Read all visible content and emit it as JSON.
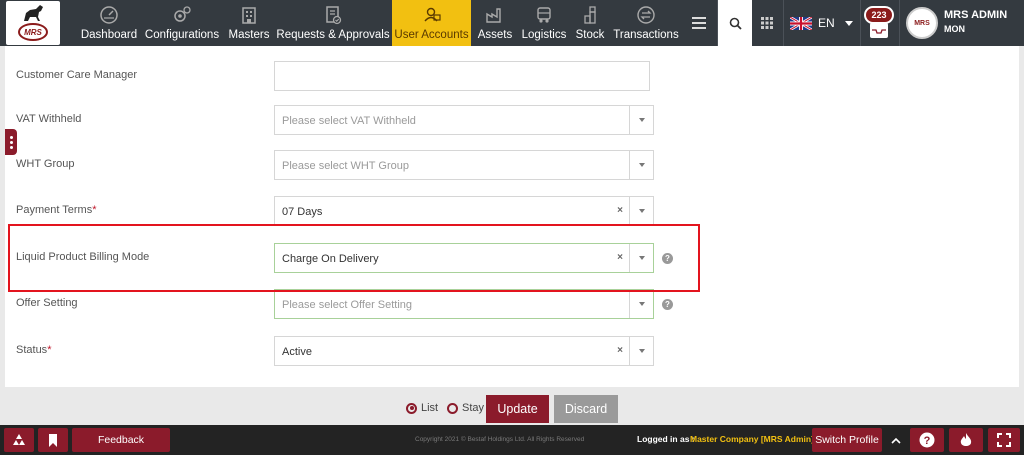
{
  "header": {
    "logo_text": "MRS",
    "nav": [
      {
        "label": "Dashboard",
        "icon": "dashboard-icon"
      },
      {
        "label": "Configurations",
        "icon": "gears-icon"
      },
      {
        "label": "Masters",
        "icon": "building-icon"
      },
      {
        "label": "Requests & Approvals",
        "icon": "document-check-icon"
      },
      {
        "label": "User Accounts",
        "icon": "user-accounts-icon",
        "active": true
      },
      {
        "label": "Assets",
        "icon": "factory-icon"
      },
      {
        "label": "Logistics",
        "icon": "truck-icon"
      },
      {
        "label": "Stock",
        "icon": "stock-icon"
      },
      {
        "label": "Transactions",
        "icon": "exchange-icon"
      }
    ],
    "language": "EN",
    "notification_count": "223",
    "user_name": "MRS ADMIN",
    "user_sub": "MON"
  },
  "form": {
    "fields": [
      {
        "label": "Customer Care Manager",
        "required": false,
        "value": "",
        "placeholder": ""
      },
      {
        "label": "VAT Withheld",
        "required": false,
        "value": "",
        "placeholder": "Please select VAT Withheld"
      },
      {
        "label": "WHT Group",
        "required": false,
        "value": "",
        "placeholder": "Please select WHT Group"
      },
      {
        "label": "Payment Terms",
        "required": true,
        "value": "07 Days",
        "placeholder": ""
      },
      {
        "label": "Liquid Product Billing Mode",
        "required": false,
        "value": "Charge On Delivery",
        "placeholder": ""
      },
      {
        "label": "Offer Setting",
        "required": false,
        "value": "",
        "placeholder": "Please select Offer Setting"
      },
      {
        "label": "Status",
        "required": true,
        "value": "Active",
        "placeholder": ""
      }
    ],
    "required_mark": "*",
    "clear_symbol": "×",
    "help_symbol": "?"
  },
  "actions": {
    "radio_list": "List",
    "radio_stay": "Stay",
    "update": "Update",
    "discard": "Discard"
  },
  "footer": {
    "feedback": "Feedback",
    "copyright": "Copyright 2021 © Bestaf Holdings Ltd. All Rights Reserved",
    "logged_in_label": "Logged in as :",
    "logged_in_value": "Master Company [MRS Admin]",
    "switch_profile": "Switch Profile"
  },
  "colors": {
    "accent": "#8b1b2b",
    "active_tab": "#f2c011",
    "highlight": "#e3141e"
  }
}
